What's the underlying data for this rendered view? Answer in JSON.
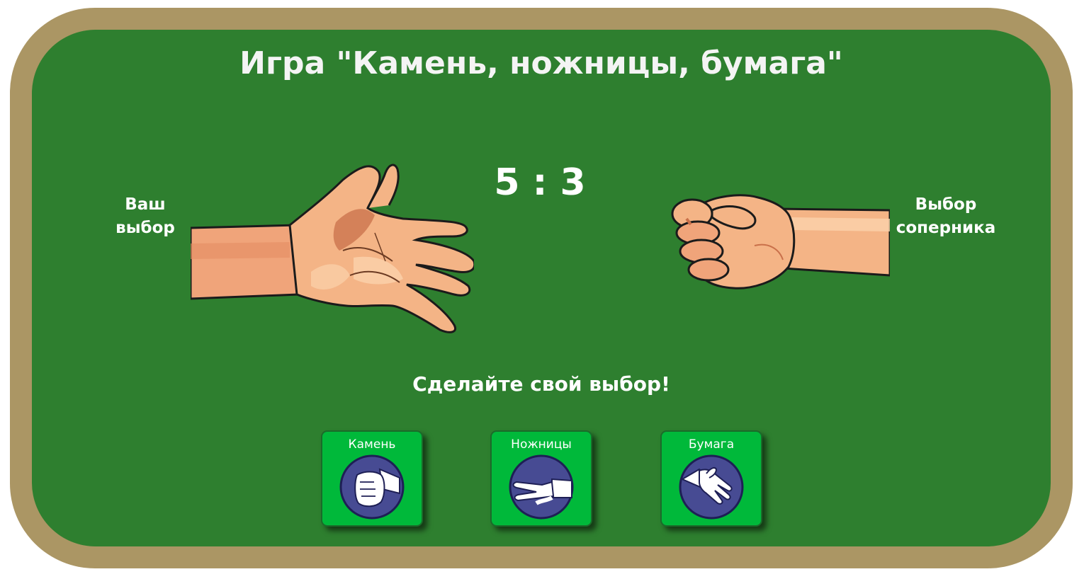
{
  "title": "Игра \"Камень, ножницы, бумага\"",
  "score": {
    "player": 5,
    "opponent": 3,
    "display": "5 : 3"
  },
  "labels": {
    "player_line1": "Ваш",
    "player_line2": "выбор",
    "opponent_line1": "Выбор",
    "opponent_line2": "соперника"
  },
  "hands": {
    "player_choice_icon": "open-hand-paper",
    "opponent_choice_icon": "fist-rock"
  },
  "prompt": "Сделайте свой выбор!",
  "choices": [
    {
      "label": "Камень",
      "icon": "rock-fist-icon"
    },
    {
      "label": "Ножницы",
      "icon": "scissors-hand-icon"
    },
    {
      "label": "Бумага",
      "icon": "paper-hand-icon"
    }
  ],
  "colors": {
    "frame": "#ab9664",
    "board": "#2e7f2f",
    "button": "#00b93a",
    "icon_circle": "#474b93"
  }
}
